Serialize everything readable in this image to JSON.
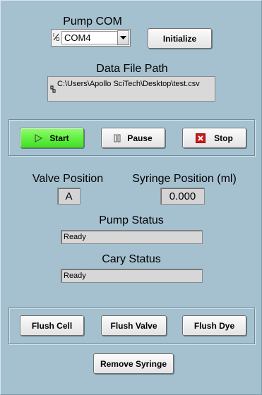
{
  "pump_com": {
    "label": "Pump COM",
    "io_glyph": "I/O",
    "selected": "COM4",
    "initialize_label": "Initialize"
  },
  "data_file": {
    "label": "Data File Path",
    "value": "C:\\Users\\Apollo SciTech\\Desktop\\test.csv"
  },
  "controls": {
    "start_label": "Start",
    "start_color": "#5dff3a",
    "pause_label": "Pause",
    "stop_label": "Stop",
    "stop_icon_color": "#d01818"
  },
  "valve": {
    "label": "Valve Position",
    "value": "A"
  },
  "syringe": {
    "label": "Syringe Position (ml)",
    "value": "0.000"
  },
  "pump_status": {
    "label": "Pump Status",
    "value": "Ready"
  },
  "cary_status": {
    "label": "Cary Status",
    "value": "Ready"
  },
  "flush": {
    "cell_label": "Flush Cell",
    "valve_label": "Flush Valve",
    "dye_label": "Flush Dye"
  },
  "remove_syringe_label": "Remove Syringe",
  "background_color": "#a5c1d0"
}
